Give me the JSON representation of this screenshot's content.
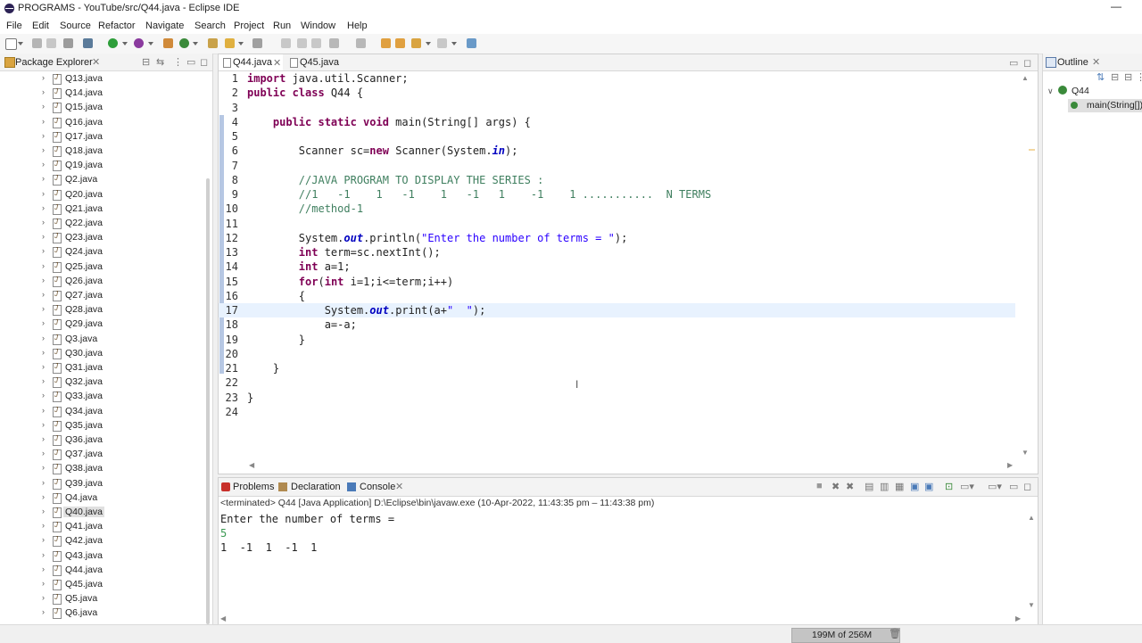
{
  "window": {
    "title": "PROGRAMS - YouTube/src/Q44.java - Eclipse IDE",
    "minimize": "—"
  },
  "menu": [
    "File",
    "Edit",
    "Source",
    "Refactor",
    "Navigate",
    "Search",
    "Project",
    "Run",
    "Window",
    "Help"
  ],
  "package_explorer": {
    "tab_label": "Package Explorer",
    "items": [
      "Q13.java",
      "Q14.java",
      "Q15.java",
      "Q16.java",
      "Q17.java",
      "Q18.java",
      "Q19.java",
      "Q2.java",
      "Q20.java",
      "Q21.java",
      "Q22.java",
      "Q23.java",
      "Q24.java",
      "Q25.java",
      "Q26.java",
      "Q27.java",
      "Q28.java",
      "Q29.java",
      "Q3.java",
      "Q30.java",
      "Q31.java",
      "Q32.java",
      "Q33.java",
      "Q34.java",
      "Q35.java",
      "Q36.java",
      "Q37.java",
      "Q38.java",
      "Q39.java",
      "Q4.java",
      "Q40.java",
      "Q41.java",
      "Q42.java",
      "Q43.java",
      "Q44.java",
      "Q45.java",
      "Q5.java",
      "Q6.java"
    ],
    "selected": "Q40.java"
  },
  "editor": {
    "tabs": [
      {
        "label": "Q44.java",
        "active": true
      },
      {
        "label": "Q45.java",
        "active": false
      }
    ],
    "lines": [
      {
        "n": "1",
        "code": [
          {
            "t": "import",
            "c": "kw"
          },
          {
            "t": " java.util.Scanner;",
            "c": ""
          }
        ]
      },
      {
        "n": "2",
        "code": [
          {
            "t": "public class",
            "c": "kw"
          },
          {
            "t": " Q44 {",
            "c": ""
          }
        ]
      },
      {
        "n": "3",
        "code": []
      },
      {
        "n": "4",
        "code": [
          {
            "t": "    public static void",
            "c": "kw"
          },
          {
            "t": " main(String[] args) {",
            "c": ""
          }
        ]
      },
      {
        "n": "5",
        "code": []
      },
      {
        "n": "6",
        "code": [
          {
            "t": "        Scanner sc=",
            "c": ""
          },
          {
            "t": "new",
            "c": "kw"
          },
          {
            "t": " Scanner(System.",
            "c": ""
          },
          {
            "t": "in",
            "c": "fd"
          },
          {
            "t": ");",
            "c": ""
          }
        ]
      },
      {
        "n": "7",
        "code": []
      },
      {
        "n": "8",
        "code": [
          {
            "t": "        //JAVA PROGRAM TO DISPLAY THE SERIES :",
            "c": "cm"
          }
        ]
      },
      {
        "n": "9",
        "code": [
          {
            "t": "        //1   -1    1   -1    1   -1   1    -1    1 ...........  N TERMS",
            "c": "cm"
          }
        ]
      },
      {
        "n": "10",
        "code": [
          {
            "t": "        //method-1",
            "c": "cm"
          }
        ]
      },
      {
        "n": "11",
        "code": []
      },
      {
        "n": "12",
        "code": [
          {
            "t": "        System.",
            "c": ""
          },
          {
            "t": "out",
            "c": "fd"
          },
          {
            "t": ".println(",
            "c": ""
          },
          {
            "t": "\"Enter the number of terms = \"",
            "c": "st"
          },
          {
            "t": ");",
            "c": ""
          }
        ]
      },
      {
        "n": "13",
        "code": [
          {
            "t": "        int",
            "c": "kw"
          },
          {
            "t": " term=sc.nextInt();",
            "c": ""
          }
        ]
      },
      {
        "n": "14",
        "code": [
          {
            "t": "        int",
            "c": "kw"
          },
          {
            "t": " a=1;",
            "c": ""
          }
        ]
      },
      {
        "n": "15",
        "code": [
          {
            "t": "        for",
            "c": "kw"
          },
          {
            "t": "(",
            "c": ""
          },
          {
            "t": "int",
            "c": "kw"
          },
          {
            "t": " i=1;i<=term;i++)",
            "c": ""
          }
        ]
      },
      {
        "n": "16",
        "code": [
          {
            "t": "        {",
            "c": ""
          }
        ]
      },
      {
        "n": "17",
        "code": [
          {
            "t": "            System.",
            "c": ""
          },
          {
            "t": "out",
            "c": "fd"
          },
          {
            "t": ".print(a+",
            "c": ""
          },
          {
            "t": "\"  \"",
            "c": "st"
          },
          {
            "t": ");",
            "c": ""
          }
        ]
      },
      {
        "n": "18",
        "code": [
          {
            "t": "            a=-a;",
            "c": ""
          }
        ]
      },
      {
        "n": "19",
        "code": [
          {
            "t": "        }",
            "c": ""
          }
        ]
      },
      {
        "n": "20",
        "code": []
      },
      {
        "n": "21",
        "code": [
          {
            "t": "    }",
            "c": ""
          }
        ]
      },
      {
        "n": "22",
        "code": []
      },
      {
        "n": "23",
        "code": [
          {
            "t": "}",
            "c": ""
          }
        ]
      },
      {
        "n": "24",
        "code": []
      }
    ],
    "highlight_line": "17"
  },
  "console": {
    "tabs": [
      "Problems",
      "Declaration",
      "Console"
    ],
    "status": "<terminated> Q44 [Java Application] D:\\Eclipse\\bin\\javaw.exe  (10-Apr-2022, 11:43:35 pm – 11:43:38 pm)",
    "lines": [
      {
        "text": "Enter the number of terms =",
        "color": "#222222"
      },
      {
        "text": "5",
        "color": "#3c9a54"
      },
      {
        "text": "1  -1  1  -1  1",
        "color": "#222222"
      }
    ]
  },
  "outline": {
    "tab_label": "Outline",
    "class_name": "Q44",
    "method": "main(String[])"
  },
  "statusbar": {
    "heap": "199M of 256M"
  },
  "colors": {
    "keyword": "#7f0055",
    "comment": "#3f7f5f",
    "string": "#2a00ff",
    "field": "#0000c0",
    "current_line": "#e8f2fe"
  }
}
